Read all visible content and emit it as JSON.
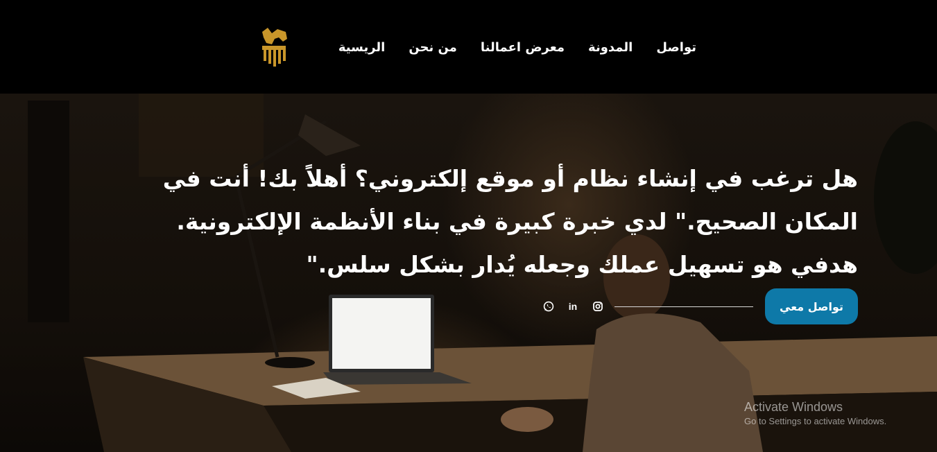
{
  "header": {
    "logo_icon": "lion-shield-logo",
    "brand_color": "#c9962a",
    "nav": [
      {
        "label": "الريسية"
      },
      {
        "label": "من نحن"
      },
      {
        "label": "معرض اعمالنا"
      },
      {
        "label": "المدونة"
      },
      {
        "label": "تواصل"
      }
    ]
  },
  "hero": {
    "headline": "هل ترغب في إنشاء نظام أو موقع إلكتروني؟ أهلاً بك! أنت في المكان الصحيح.\" لدي خبرة كبيرة في بناء الأنظمة الإلكترونية. هدفي هو تسهيل عملك وجعله يُدار بشكل سلس.\"",
    "cta_label": "تواصل معي",
    "cta_color": "#0e79a8",
    "social": [
      {
        "icon": "instagram-icon"
      },
      {
        "icon": "linkedin-icon",
        "text": "in"
      },
      {
        "icon": "whatsapp-icon"
      }
    ]
  },
  "watermark": {
    "title": "Activate Windows",
    "subtitle": "Go to Settings to activate Windows."
  }
}
